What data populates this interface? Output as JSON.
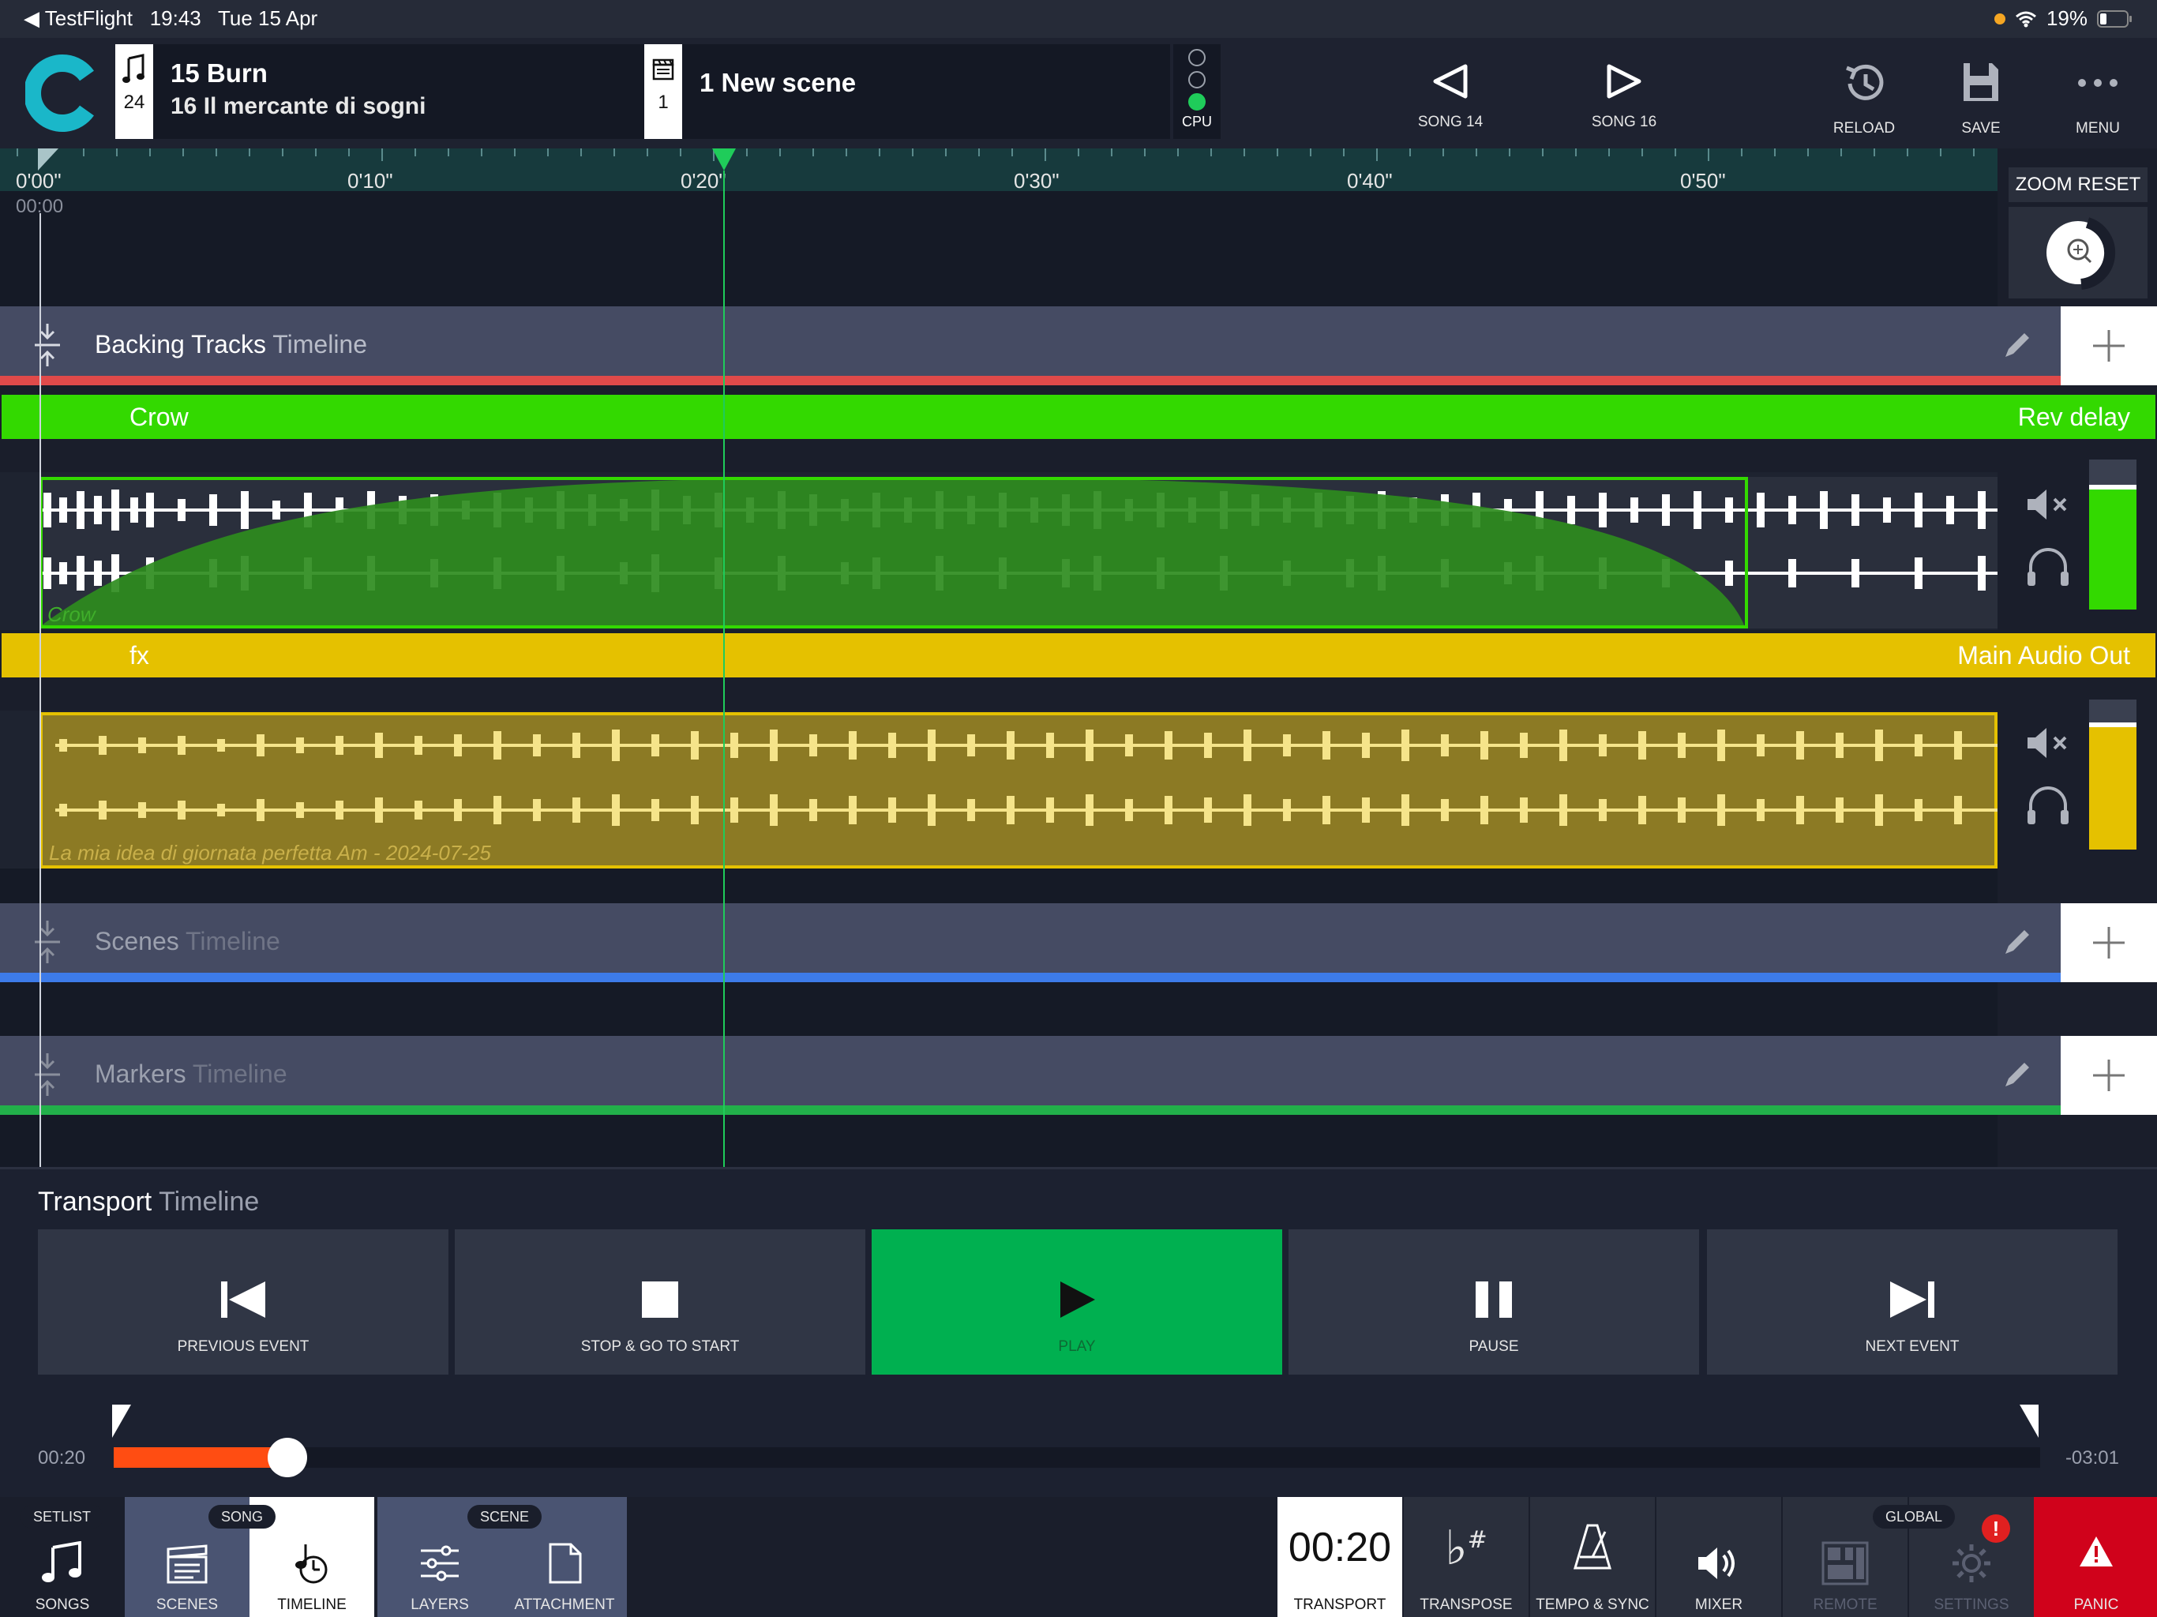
{
  "status": {
    "app": "TestFlight",
    "time": "19:43",
    "date": "Tue 15 Apr",
    "battery": "19%"
  },
  "header": {
    "song_count": "24",
    "current_song": "15 Burn",
    "next_song": "16 Il mercante di sogni",
    "scene_number": "1",
    "scene_title": "1 New scene",
    "cpu_label": "CPU",
    "prev_song": "SONG 14",
    "next_song_btn": "SONG 16",
    "reload": "RELOAD",
    "save": "SAVE",
    "menu": "MENU"
  },
  "ruler": {
    "ticks": [
      "0'00\"",
      "0'10\"",
      "0'20\"",
      "0'30\"",
      "0'40\"",
      "0'50\""
    ],
    "position": "00:00",
    "zoom_reset": "ZOOM RESET"
  },
  "sections": {
    "backing": {
      "title": "Backing Tracks",
      "sub": "Timeline"
    },
    "scenes": {
      "title": "Scenes",
      "sub": "Timeline"
    },
    "markers": {
      "title": "Markers",
      "sub": "Timeline"
    }
  },
  "tracks": [
    {
      "name": "Crow",
      "output": "Rev delay",
      "clip": "Crow",
      "color": "#33d900",
      "level": 0.83
    },
    {
      "name": "fx",
      "output": "Main Audio Out",
      "clip": "La mia idea di giornata perfetta Am - 2024-07-25",
      "color": "#e5c100",
      "level": 0.85
    }
  ],
  "transport": {
    "title": "Transport",
    "sub": "Timeline",
    "buttons": [
      "PREVIOUS EVENT",
      "STOP & GO TO START",
      "PLAY",
      "PAUSE",
      "NEXT EVENT"
    ],
    "elapsed": "00:20",
    "remaining": "-03:01",
    "progress": 0.09
  },
  "bottom": {
    "setlist": "SETLIST",
    "song": "SONG",
    "scene": "SCENE",
    "global": "GLOBAL",
    "songs": "SONGS",
    "scenes": "SCENES",
    "timeline": "TIMELINE",
    "layers": "LAYERS",
    "attachment": "ATTACHMENT",
    "clock": "00:20",
    "transport": "TRANSPORT",
    "transpose": "TRANSPOSE",
    "tempo": "TEMPO & SYNC",
    "mixer": "MIXER",
    "remote": "REMOTE",
    "settings": "SETTINGS",
    "panic": "PANIC",
    "settings_badge": "!"
  },
  "colors": {
    "backing_bar": "#e04a4a",
    "scenes_bar": "#3d7be8",
    "markers_bar": "#22b04a",
    "accent_play": "#00b050",
    "progress": "#ff4d12"
  }
}
